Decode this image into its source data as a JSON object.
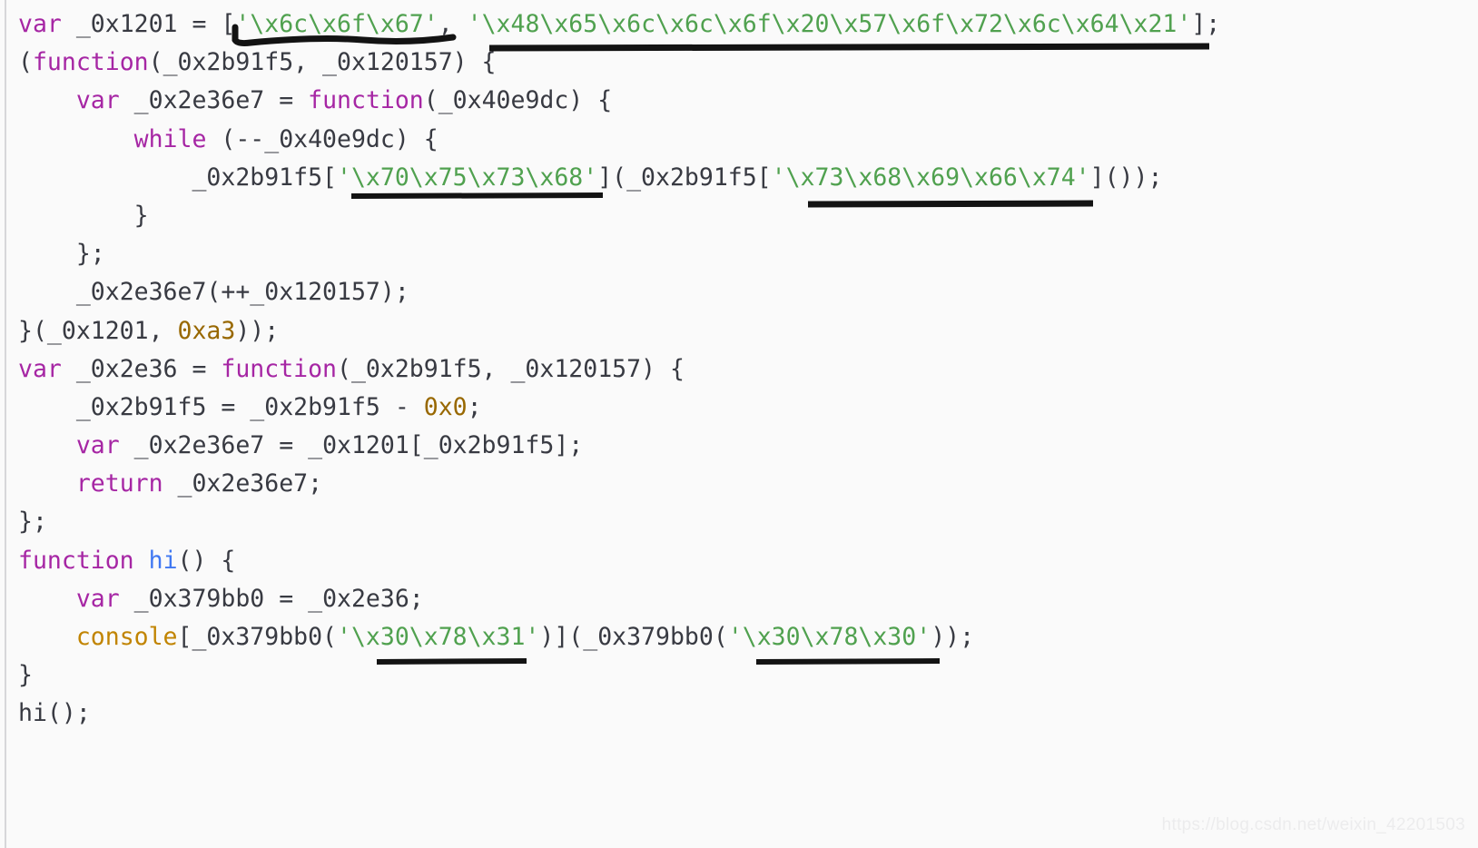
{
  "viewer": {
    "background_color": "#fafafa",
    "gutter_rule_color": "#d7d7d9",
    "font_size_px": "26.5",
    "language": "javascript"
  },
  "theme": {
    "keyword_color": "#a626a4",
    "string_color": "#50a14f",
    "number_color": "#986801",
    "function_name_color": "#4078f2",
    "global_object_color": "#c18401",
    "plain_text_color": "#383a42",
    "annotation_color": "#111111"
  },
  "code": {
    "line_01": {
      "kw_var": "var",
      "t1": " _0x1201 = [",
      "s1": "'\\x6c\\x6f\\x67'",
      "t2": ", ",
      "s2": "'\\x48\\x65\\x6c\\x6c\\x6f\\x20\\x57\\x6f\\x72\\x6c\\x64\\x21'",
      "t3": "];"
    },
    "line_02": {
      "t1": "(",
      "kw_function": "function",
      "t2": "(_0x2b91f5, _0x120157) {"
    },
    "line_03": {
      "kw_var": "var",
      "t1": " _0x2e36e7 = ",
      "kw_function": "function",
      "t2": "(_0x40e9dc) {"
    },
    "line_04": {
      "kw_while": "while",
      "t1": " (--_0x40e9dc) {"
    },
    "line_05": {
      "t1": "_0x2b91f5[",
      "s1": "'\\x70\\x75\\x73\\x68'",
      "t2": "](_0x2b91f5[",
      "s2": "'\\x73\\x68\\x69\\x66\\x74'",
      "t3": "]());"
    },
    "line_06": {
      "t1": "}"
    },
    "line_07": {
      "t1": "};"
    },
    "line_08": {
      "t1": "_0x2e36e7(++_0x120157);"
    },
    "line_09": {
      "t1": "}(_0x1201, ",
      "n1": "0xa3",
      "t2": "));"
    },
    "line_10": {
      "kw_var": "var",
      "t1": " _0x2e36 = ",
      "kw_function": "function",
      "t2": "(_0x2b91f5, _0x120157) {"
    },
    "line_11": {
      "t1": "_0x2b91f5 = _0x2b91f5 - ",
      "n1": "0x0",
      "t2": ";"
    },
    "line_12": {
      "kw_var": "var",
      "t1": " _0x2e36e7 = _0x1201[_0x2b91f5];"
    },
    "line_13": {
      "kw_return": "return",
      "t1": " _0x2e36e7;"
    },
    "line_14": {
      "t1": "};"
    },
    "line_15": {
      "kw_function": "function",
      "t1": " ",
      "fn_name": "hi",
      "t2": "() {"
    },
    "line_16": {
      "kw_var": "var",
      "t1": " _0x379bb0 = _0x2e36;"
    },
    "line_17": {
      "g1": "console",
      "t1": "[_0x379bb0(",
      "s1": "'\\x30\\x78\\x31'",
      "t2": ")](_0x379bb0(",
      "s2": "'\\x30\\x78\\x30'",
      "t3": "));"
    },
    "line_18": {
      "t1": "}"
    },
    "line_19": {
      "t1": "hi();"
    }
  },
  "annotations": {
    "description": "hand drawn black marker underlines highlighting six hex-escaped string literals",
    "count": 6,
    "items": [
      {
        "label": "underline-log-string"
      },
      {
        "label": "underline-hello-world-string"
      },
      {
        "label": "underline-push-string"
      },
      {
        "label": "underline-shift-string"
      },
      {
        "label": "underline-0x1-string"
      },
      {
        "label": "underline-0x0-string"
      }
    ]
  },
  "watermark": {
    "text": "https://blog.csdn.net/weixin_42201503"
  }
}
